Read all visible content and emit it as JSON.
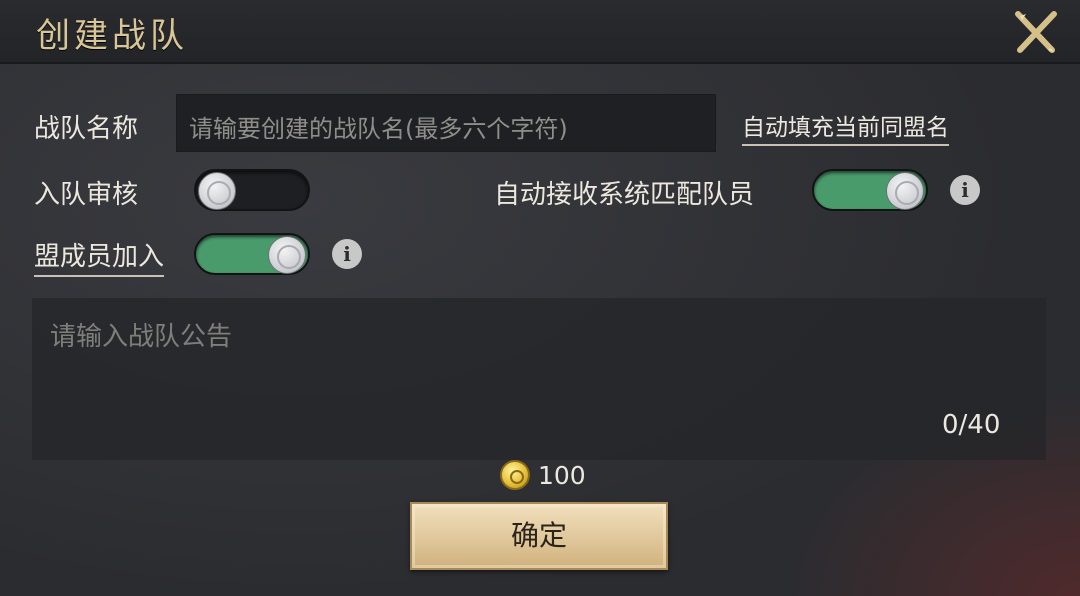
{
  "header": {
    "title": "创建战队",
    "close_icon": "close-x-icon"
  },
  "form": {
    "team_name_label": "战队名称",
    "team_name_placeholder": "请输要创建的战队名(最多六个字符)",
    "autofill_link": "自动填充当前同盟名",
    "join_review_label": "入队审核",
    "join_review_on": false,
    "auto_accept_label": "自动接收系统匹配队员",
    "auto_accept_on": true,
    "alliance_join_label": "盟成员加入",
    "alliance_join_on": true,
    "info_glyph": "i"
  },
  "notice": {
    "placeholder": "请输入战队公告",
    "char_count": "0/40"
  },
  "cost": {
    "icon": "gold-coin-icon",
    "value": "100"
  },
  "confirm_label": "确定",
  "colors": {
    "title_gold": "#d9c697",
    "toggle_on": "#4a9b6b",
    "toggle_off": "#1e1f22",
    "button_bg": "#e0c79b"
  }
}
